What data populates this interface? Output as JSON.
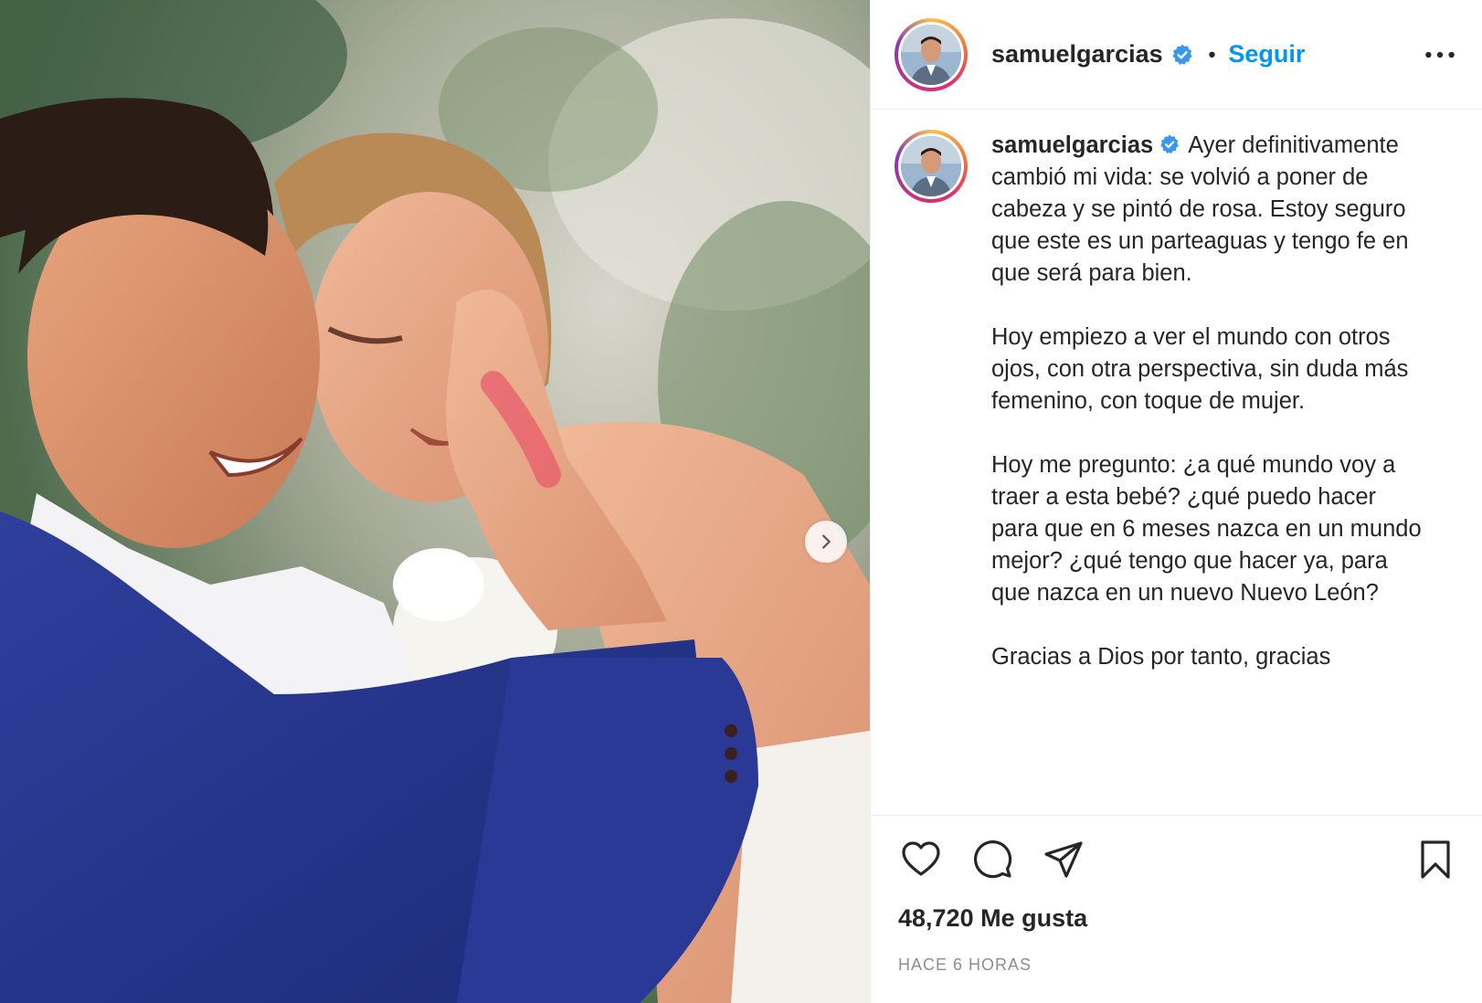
{
  "post": {
    "photo": {
      "alt_icon": "photo-image",
      "next_icon": "chevron-right-icon"
    },
    "header": {
      "username": "samuelgarcias",
      "separator": "•",
      "follow_label": "Seguir",
      "more_icon": "more-horizontal-icon"
    },
    "caption": {
      "username": "samuelgarcias",
      "text": "Ayer definitivamente cambió mi vida: se volvió a poner de cabeza y se pintó de rosa. Estoy seguro que este es un parteaguas y tengo fe en que será para bien.\n\nHoy empiezo a ver el mundo con otros ojos, con otra perspectiva, sin duda más femenino, con toque de mujer.\n\nHoy me pregunto: ¿a qué mundo voy a traer a esta bebé? ¿qué puedo hacer para que en 6 meses nazca en un mundo mejor? ¿qué tengo que hacer ya, para que nazca en un nuevo Nuevo León?\n\nGracias a Dios por tanto, gracias"
    },
    "actions": {
      "like_icon": "heart-icon",
      "comment_icon": "comment-icon",
      "share_icon": "send-icon",
      "save_icon": "bookmark-icon"
    },
    "likes_text": "48,720 Me gusta",
    "timestamp": "HACE 6 HORAS"
  },
  "colors": {
    "accent": "#0095f6",
    "text": "#262626",
    "muted": "#8e8e8e",
    "verified": "#3897f0"
  }
}
